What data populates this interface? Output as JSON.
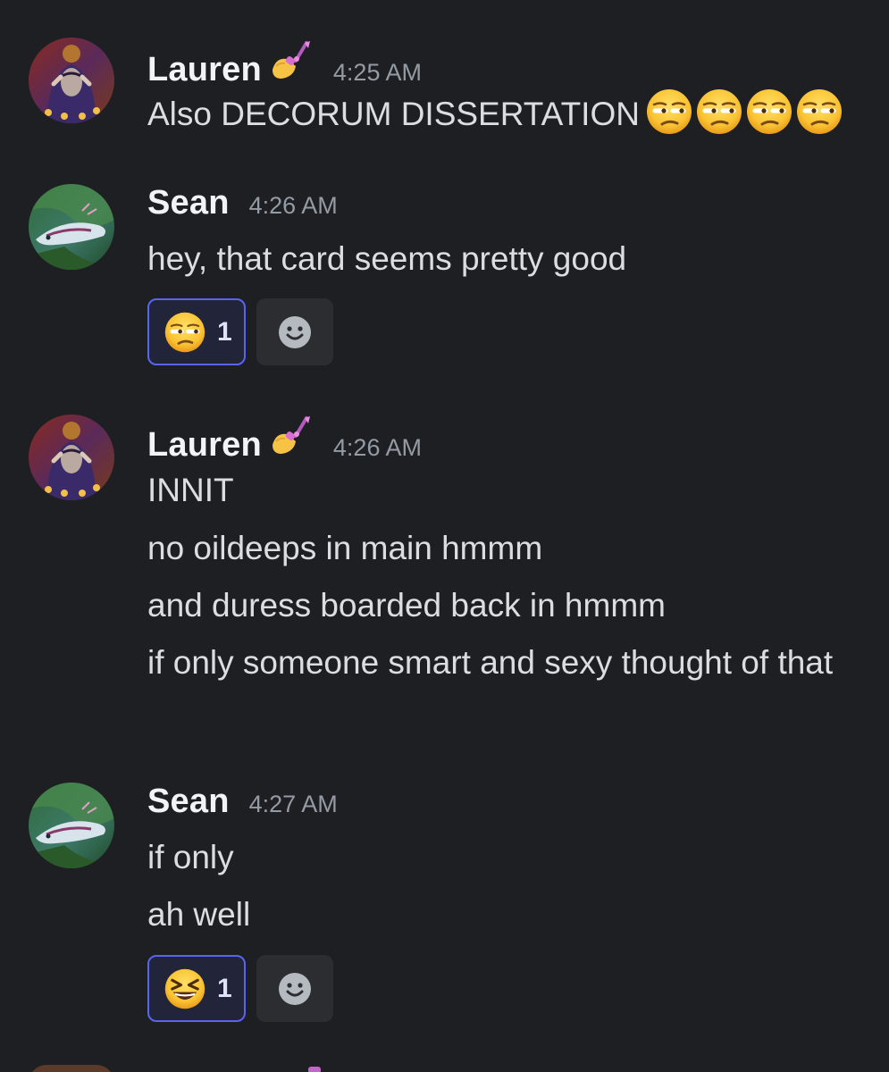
{
  "messages": [
    {
      "user": "Lauren",
      "badge_icon": "nail-polish-emoji",
      "time": "4:25 AM",
      "lines": [
        "Also DECORUM DISSERTATION"
      ],
      "trailing_emoji": [
        "unamused-face-emoji",
        "unamused-face-emoji",
        "unamused-face-emoji",
        "unamused-face-emoji"
      ]
    },
    {
      "user": "Sean",
      "time": "4:26 AM",
      "lines": [
        "hey, that card seems pretty good"
      ],
      "reaction": {
        "emoji": "unamused-face-emoji",
        "count": "1"
      }
    },
    {
      "user": "Lauren",
      "badge_icon": "nail-polish-emoji",
      "time": "4:26 AM",
      "lines": [
        "INNIT",
        "no oildeeps in main hmmm",
        "and duress boarded back in hmmm",
        "if only someone smart and sexy thought of that"
      ]
    },
    {
      "user": "Sean",
      "time": "4:27 AM",
      "lines": [
        "if only",
        "ah well"
      ],
      "reaction": {
        "emoji": "grinning-squinting-face-emoji",
        "count": "1"
      }
    }
  ],
  "colors": {
    "background": "#1e1f22",
    "reaction_active_border": "#5865f2",
    "timestamp": "#949ba4"
  }
}
